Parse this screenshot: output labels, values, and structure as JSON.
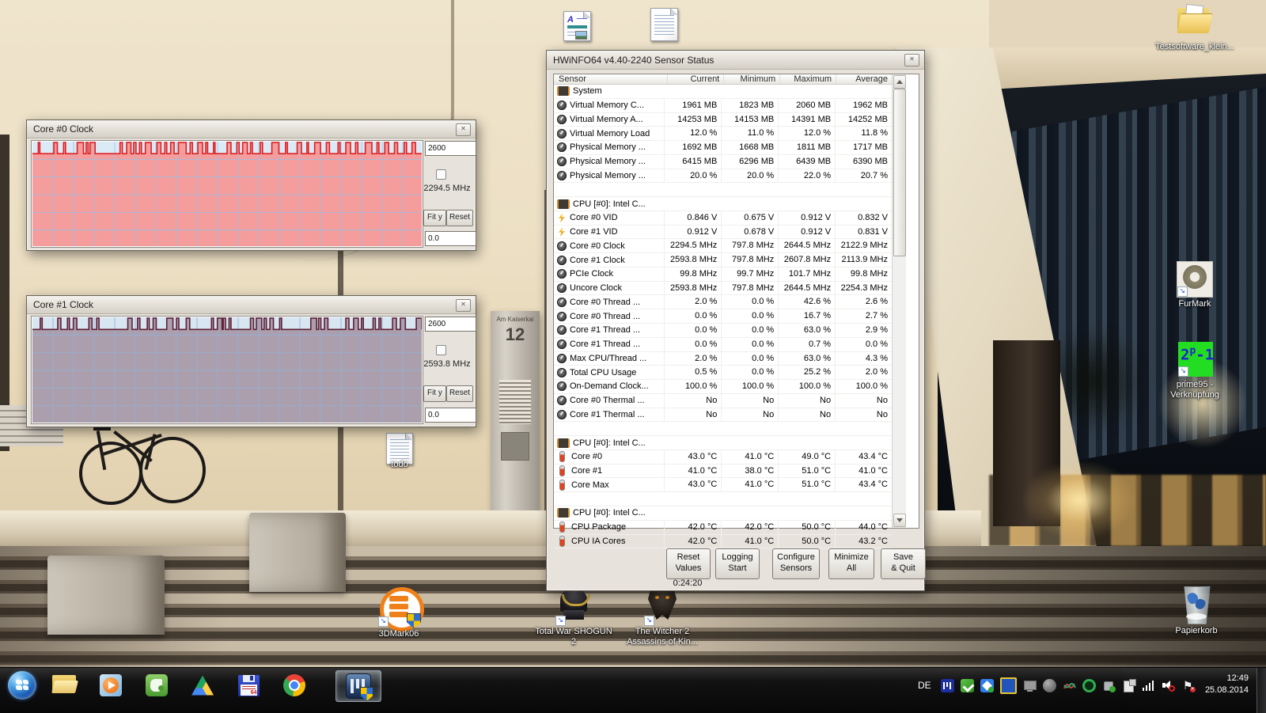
{
  "background": {
    "street_sign_line1": "Am Kaiserkai",
    "street_sign_line2": "12"
  },
  "graph_windows": {
    "core0": {
      "title": "Core #0 Clock",
      "y_max": "2600",
      "y_min": "0.0",
      "current": "2294.5 MHz",
      "fit_button": "Fit y",
      "reset_button": "Reset",
      "colors": {
        "plot_bg": "#daeaf7",
        "fill": "#f59c9c",
        "grid": "#9fc0e2",
        "line": "#e02020"
      },
      "baseline_frac": 0.115,
      "spikes": [
        [
          1.5,
          0.4
        ],
        [
          5.5,
          0.9
        ],
        [
          8.0,
          0.5
        ],
        [
          11.5,
          1.6
        ],
        [
          13.8,
          0.5
        ],
        [
          14.8,
          1.3
        ],
        [
          22.5,
          0.6
        ],
        [
          24.2,
          1.1
        ],
        [
          26.0,
          0.6
        ],
        [
          27.5,
          0.5
        ],
        [
          29.0,
          1.5
        ],
        [
          32.0,
          1.0
        ],
        [
          34.0,
          0.5
        ],
        [
          35.5,
          0.9
        ],
        [
          37.5,
          2.0
        ],
        [
          40.5,
          0.6
        ],
        [
          42.5,
          1.2
        ],
        [
          44.5,
          0.5
        ],
        [
          46.5,
          0.4
        ],
        [
          50.0,
          1.0
        ],
        [
          52.5,
          0.6
        ],
        [
          54.0,
          1.2
        ],
        [
          56.0,
          0.5
        ],
        [
          58.5,
          0.6
        ],
        [
          61.5,
          1.8
        ],
        [
          65.0,
          0.5
        ],
        [
          68.0,
          1.1
        ],
        [
          70.5,
          0.4
        ],
        [
          72.5,
          1.5
        ],
        [
          75.5,
          0.8
        ],
        [
          78.5,
          0.5
        ],
        [
          80.5,
          1.2
        ],
        [
          83.0,
          0.6
        ],
        [
          85.5,
          1.7
        ],
        [
          88.5,
          0.5
        ],
        [
          90.5,
          1.0
        ],
        [
          93.0,
          0.8
        ],
        [
          95.5,
          0.6
        ],
        [
          97.5,
          0.9
        ]
      ]
    },
    "core1": {
      "title": "Core #1 Clock",
      "y_max": "2600",
      "y_min": "0.0",
      "current": "2593.8 MHz",
      "fit_button": "Fit y",
      "reset_button": "Reset",
      "colors": {
        "plot_bg": "#d8e6f2",
        "fill": "#ab9fae",
        "grid": "#93aed2",
        "line": "#5f1f35"
      },
      "baseline_frac": 0.115,
      "spikes": [
        [
          2.0,
          0.5
        ],
        [
          6.5,
          0.8
        ],
        [
          9.0,
          0.5
        ],
        [
          10.5,
          0.9
        ],
        [
          14.5,
          0.8
        ],
        [
          16.5,
          0.6
        ],
        [
          24.5,
          1.1
        ],
        [
          27.0,
          0.6
        ],
        [
          29.5,
          0.5
        ],
        [
          31.0,
          0.8
        ],
        [
          34.5,
          1.6
        ],
        [
          37.0,
          0.6
        ],
        [
          39.5,
          0.9
        ],
        [
          46.0,
          0.5
        ],
        [
          47.5,
          1.2
        ],
        [
          49.0,
          0.6
        ],
        [
          50.5,
          0.5
        ],
        [
          56.0,
          0.8
        ],
        [
          57.5,
          1.4
        ],
        [
          59.5,
          0.6
        ],
        [
          61.0,
          0.9
        ],
        [
          63.5,
          0.5
        ],
        [
          71.5,
          1.5
        ],
        [
          73.5,
          0.6
        ],
        [
          75.0,
          0.9
        ],
        [
          80.5,
          0.8
        ],
        [
          82.5,
          1.2
        ],
        [
          84.5,
          0.5
        ],
        [
          87.5,
          0.6
        ],
        [
          89.0,
          0.5
        ],
        [
          92.5,
          1.0
        ],
        [
          94.5,
          1.3
        ],
        [
          98.6,
          1.4
        ]
      ]
    }
  },
  "hwinfo": {
    "title": "HWiNFO64 v4.40-2240 Sensor Status",
    "columns": [
      "Sensor",
      "Current",
      "Minimum",
      "Maximum",
      "Average"
    ],
    "rows": [
      {
        "type": "section",
        "icon": "chip",
        "label": "System"
      },
      {
        "type": "value",
        "icon": "gauge",
        "label": "Virtual Memory C...",
        "values": [
          "1961 MB",
          "1823 MB",
          "2060 MB",
          "1962 MB"
        ]
      },
      {
        "type": "value",
        "icon": "gauge",
        "label": "Virtual Memory A...",
        "values": [
          "14253 MB",
          "14153 MB",
          "14391 MB",
          "14252 MB"
        ]
      },
      {
        "type": "value",
        "icon": "gauge",
        "label": "Virtual Memory Load",
        "values": [
          "12.0 %",
          "11.0 %",
          "12.0 %",
          "11.8 %"
        ]
      },
      {
        "type": "value",
        "icon": "gauge",
        "label": "Physical Memory ...",
        "values": [
          "1692 MB",
          "1668 MB",
          "1811 MB",
          "1717 MB"
        ]
      },
      {
        "type": "value",
        "icon": "gauge",
        "label": "Physical Memory ...",
        "values": [
          "6415 MB",
          "6296 MB",
          "6439 MB",
          "6390 MB"
        ]
      },
      {
        "type": "value",
        "icon": "gauge",
        "label": "Physical Memory ...",
        "values": [
          "20.0 %",
          "20.0 %",
          "22.0 %",
          "20.7 %"
        ]
      },
      {
        "type": "spacer"
      },
      {
        "type": "section",
        "icon": "chip",
        "label": "CPU [#0]: Intel C..."
      },
      {
        "type": "value",
        "icon": "bolt",
        "label": "Core #0 VID",
        "values": [
          "0.846 V",
          "0.675 V",
          "0.912 V",
          "0.832 V"
        ]
      },
      {
        "type": "value",
        "icon": "bolt",
        "label": "Core #1 VID",
        "values": [
          "0.912 V",
          "0.678 V",
          "0.912 V",
          "0.831 V"
        ]
      },
      {
        "type": "value",
        "icon": "gauge",
        "label": "Core #0 Clock",
        "values": [
          "2294.5 MHz",
          "797.8 MHz",
          "2644.5 MHz",
          "2122.9 MHz"
        ]
      },
      {
        "type": "value",
        "icon": "gauge",
        "label": "Core #1 Clock",
        "values": [
          "2593.8 MHz",
          "797.8 MHz",
          "2607.8 MHz",
          "2113.9 MHz"
        ]
      },
      {
        "type": "value",
        "icon": "gauge",
        "label": "PCIe Clock",
        "values": [
          "99.8 MHz",
          "99.7 MHz",
          "101.7 MHz",
          "99.8 MHz"
        ]
      },
      {
        "type": "value",
        "icon": "gauge",
        "label": "Uncore Clock",
        "values": [
          "2593.8 MHz",
          "797.8 MHz",
          "2644.5 MHz",
          "2254.3 MHz"
        ]
      },
      {
        "type": "value",
        "icon": "gauge",
        "label": "Core #0 Thread ...",
        "values": [
          "2.0 %",
          "0.0 %",
          "42.6 %",
          "2.6 %"
        ]
      },
      {
        "type": "value",
        "icon": "gauge",
        "label": "Core #0 Thread ...",
        "values": [
          "0.0 %",
          "0.0 %",
          "16.7 %",
          "2.7 %"
        ]
      },
      {
        "type": "value",
        "icon": "gauge",
        "label": "Core #1 Thread ...",
        "values": [
          "0.0 %",
          "0.0 %",
          "63.0 %",
          "2.9 %"
        ]
      },
      {
        "type": "value",
        "icon": "gauge",
        "label": "Core #1 Thread ...",
        "values": [
          "0.0 %",
          "0.0 %",
          "0.7 %",
          "0.0 %"
        ]
      },
      {
        "type": "value",
        "icon": "gauge",
        "label": "Max CPU/Thread ...",
        "values": [
          "2.0 %",
          "0.0 %",
          "63.0 %",
          "4.3 %"
        ]
      },
      {
        "type": "value",
        "icon": "gauge",
        "label": "Total CPU Usage",
        "values": [
          "0.5 %",
          "0.0 %",
          "25.2 %",
          "2.0 %"
        ]
      },
      {
        "type": "value",
        "icon": "gauge",
        "label": "On-Demand Clock...",
        "values": [
          "100.0 %",
          "100.0 %",
          "100.0 %",
          "100.0 %"
        ]
      },
      {
        "type": "value",
        "icon": "gauge",
        "label": "Core #0 Thermal ...",
        "values": [
          "No",
          "No",
          "No",
          "No"
        ]
      },
      {
        "type": "value",
        "icon": "gauge",
        "label": "Core #1 Thermal ...",
        "values": [
          "No",
          "No",
          "No",
          "No"
        ]
      },
      {
        "type": "spacer"
      },
      {
        "type": "section",
        "icon": "chip",
        "label": "CPU [#0]: Intel C..."
      },
      {
        "type": "value",
        "icon": "thermo",
        "label": "Core #0",
        "values": [
          "43.0 °C",
          "41.0 °C",
          "49.0 °C",
          "43.4 °C"
        ]
      },
      {
        "type": "value",
        "icon": "thermo",
        "label": "Core #1",
        "values": [
          "41.0 °C",
          "38.0 °C",
          "51.0 °C",
          "41.0 °C"
        ]
      },
      {
        "type": "value",
        "icon": "thermo",
        "label": "Core Max",
        "values": [
          "43.0 °C",
          "41.0 °C",
          "51.0 °C",
          "43.4 °C"
        ]
      },
      {
        "type": "spacer"
      },
      {
        "type": "section",
        "icon": "chip",
        "label": "CPU [#0]: Intel C..."
      },
      {
        "type": "value",
        "icon": "thermo",
        "label": "CPU Package",
        "values": [
          "42.0 °C",
          "42.0 °C",
          "50.0 °C",
          "44.0 °C"
        ]
      },
      {
        "type": "value",
        "icon": "thermo",
        "label": "CPU IA Cores",
        "values": [
          "42.0 °C",
          "41.0 °C",
          "50.0 °C",
          "43.2 °C"
        ]
      }
    ],
    "buttons": [
      {
        "line1": "Reset",
        "line2": "Values"
      },
      {
        "line1": "Logging",
        "line2": "Start"
      },
      {
        "line1": "Configure",
        "line2": "Sensors"
      },
      {
        "line1": "Minimize",
        "line2": "All"
      },
      {
        "line1": "Save",
        "line2": "& Quit"
      }
    ],
    "timer": "0:24:20"
  },
  "desktop_icons": {
    "testsoftware": {
      "label": "Testsoftware_klein..."
    },
    "furmark": {
      "label": "FurMark"
    },
    "prime95": {
      "label1": "prime95 -",
      "label2": "Verknüpfung"
    },
    "todo": {
      "label": "todo"
    },
    "dmark06": {
      "label": "3DMark06"
    },
    "shogun": {
      "label1": "Total War SHOGUN",
      "label2": "2"
    },
    "witcher": {
      "label1": "The Witcher 2",
      "label2": "Assassins of Kin..."
    },
    "papierkorb": {
      "label": "Papierkorb"
    }
  },
  "taskbar": {
    "language": "DE",
    "clock": {
      "time": "12:49",
      "date": "25.08.2014"
    },
    "floppy_label": "64"
  }
}
